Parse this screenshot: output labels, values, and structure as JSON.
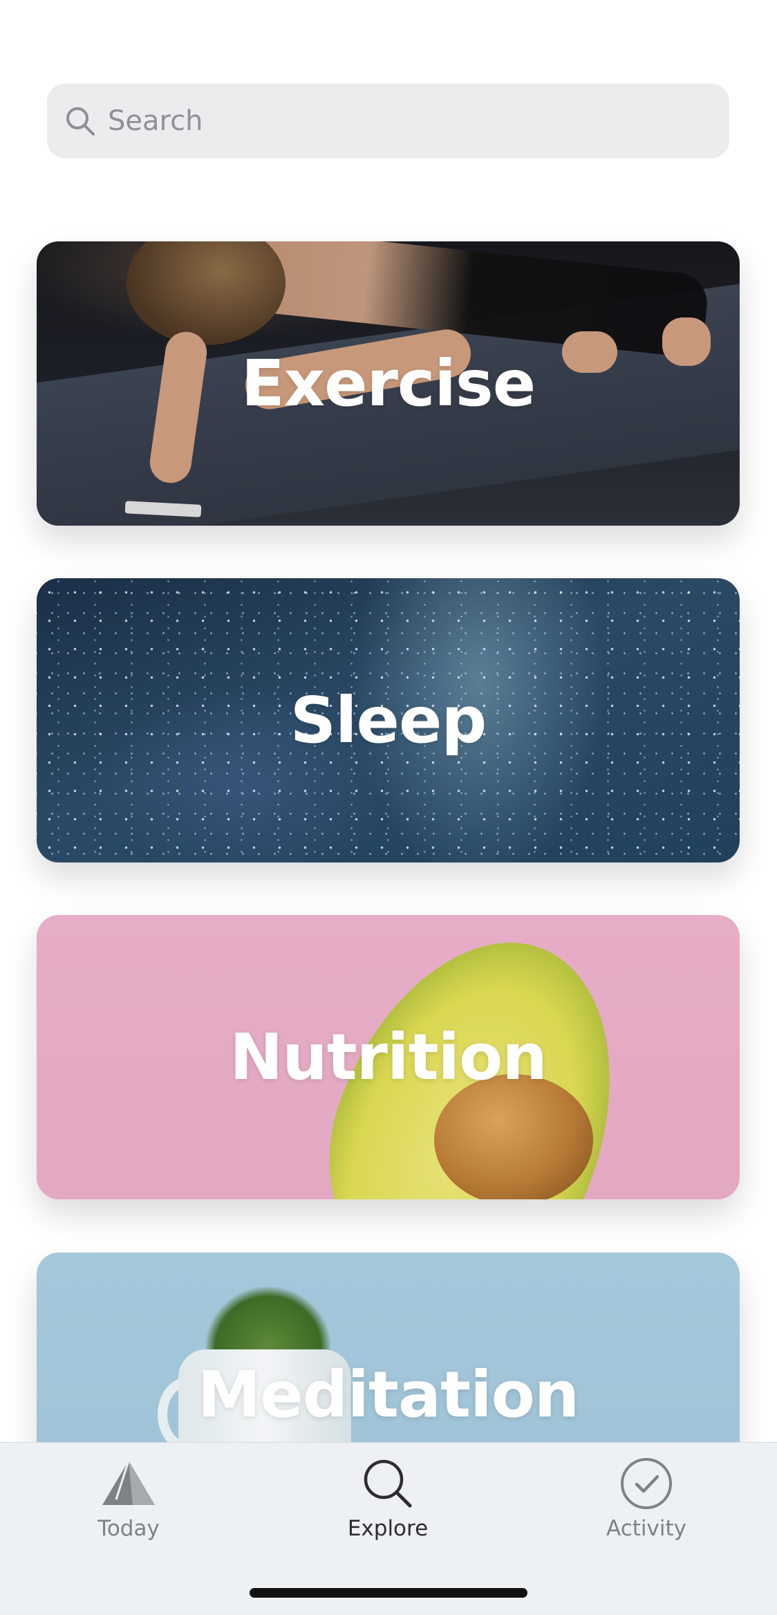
{
  "search": {
    "placeholder": "Search",
    "icon": "search-icon"
  },
  "categories": [
    {
      "title": "Exercise"
    },
    {
      "title": "Sleep"
    },
    {
      "title": "Nutrition"
    },
    {
      "title": "Meditation"
    }
  ],
  "tabbar": {
    "tabs": [
      {
        "label": "Today",
        "icon": "today-icon",
        "active": false
      },
      {
        "label": "Explore",
        "icon": "search-icon",
        "active": true
      },
      {
        "label": "Activity",
        "icon": "check-circle-icon",
        "active": false
      }
    ]
  },
  "colors": {
    "active_tab": "#2b2d30",
    "inactive_tab": "#7d8287",
    "search_bg": "#ececee"
  }
}
